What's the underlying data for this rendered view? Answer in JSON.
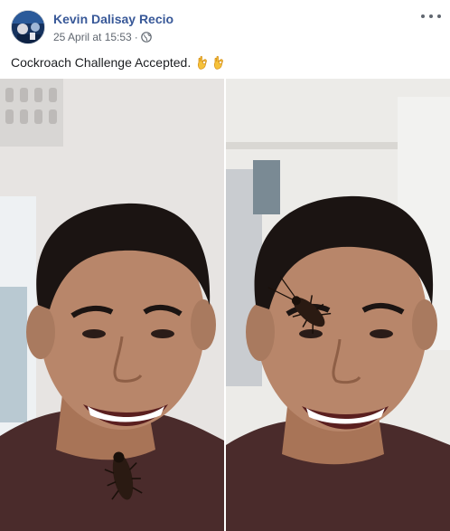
{
  "post": {
    "author": "Kevin Dalisay Recio",
    "timestamp": "25 April at 15:53",
    "separator": "·",
    "privacy_icon": "globe-icon",
    "more_icon": "more-options-icon",
    "caption_text": "Cockroach Challenge Accepted.",
    "caption_emoji": [
      "ok-hand-emoji",
      "ok-hand-emoji"
    ]
  },
  "photos": [
    {
      "name": "photo-left",
      "description_icon": "selfie-photo"
    },
    {
      "name": "photo-right",
      "description_icon": "selfie-photo"
    }
  ],
  "colors": {
    "author_link": "#385898",
    "meta_text": "#606770",
    "shirt": "#4a2b2b",
    "skin": "#b8866a",
    "hair": "#1b1412"
  }
}
